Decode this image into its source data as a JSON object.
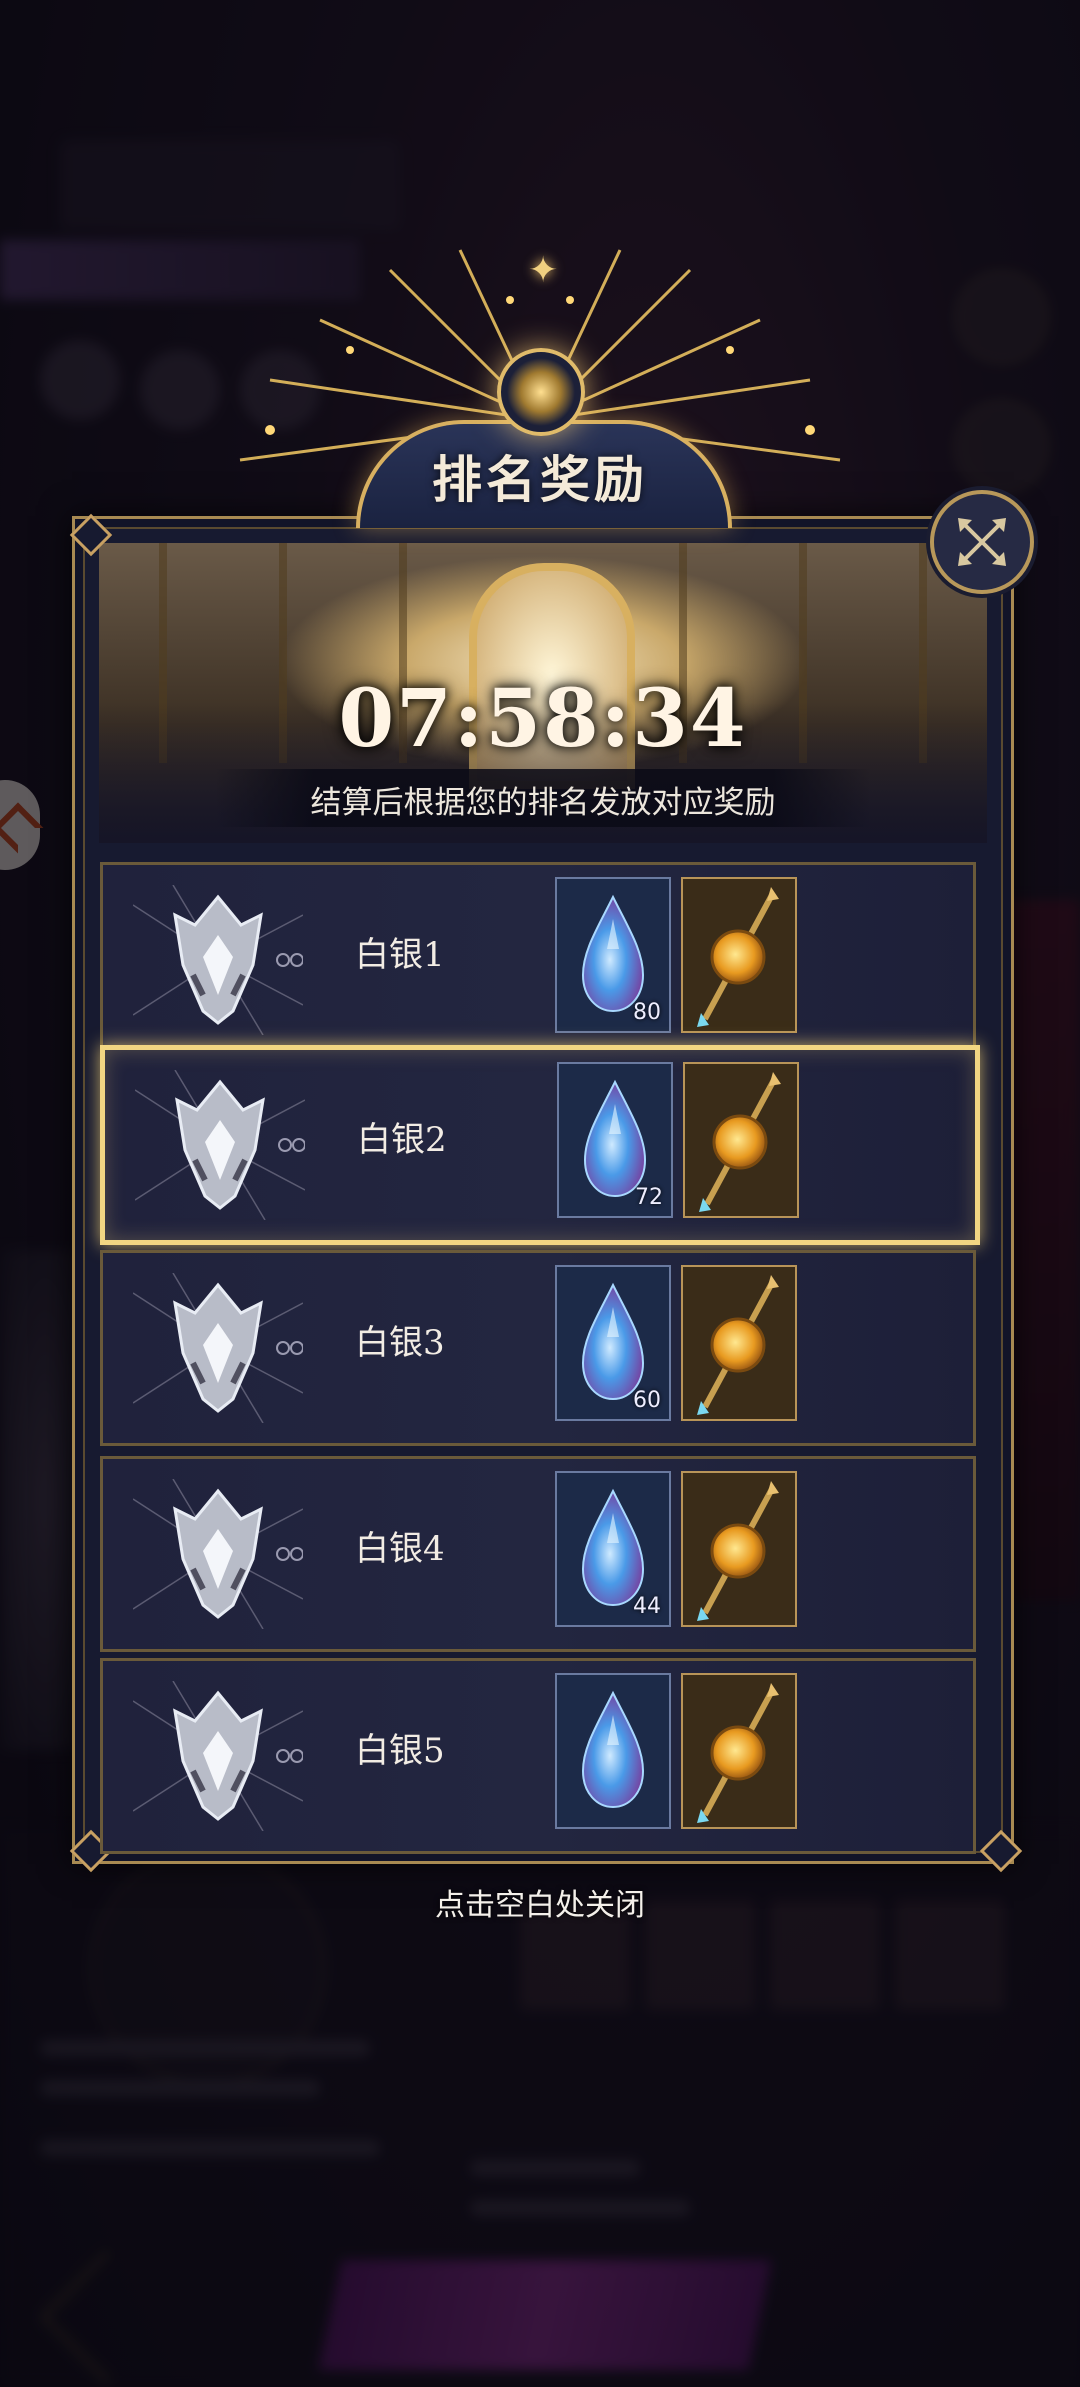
{
  "title": "排名奖励",
  "timer": "07:58:34",
  "subtitle": "结算后根据您的排名发放对应奖励",
  "ranks": [
    {
      "label": "白银1",
      "gem_count": "80",
      "highlight": false
    },
    {
      "label": "白银2",
      "gem_count": "72",
      "highlight": true
    },
    {
      "label": "白银3",
      "gem_count": "60",
      "highlight": false
    },
    {
      "label": "白银4",
      "gem_count": "44",
      "highlight": false
    },
    {
      "label": "白银5",
      "gem_count": "",
      "highlight": false
    }
  ],
  "hint": "点击空白处关闭",
  "icons": {
    "close": "close-x-icon",
    "gem": "blue-crystal-gem-icon",
    "potion": "golden-potion-scepter-icon",
    "rank": "silver-crown-emblem-icon"
  },
  "colors": {
    "gold_border": "#c8a062",
    "highlight_border": "#f2d682",
    "panel_bg": "#171a30"
  }
}
